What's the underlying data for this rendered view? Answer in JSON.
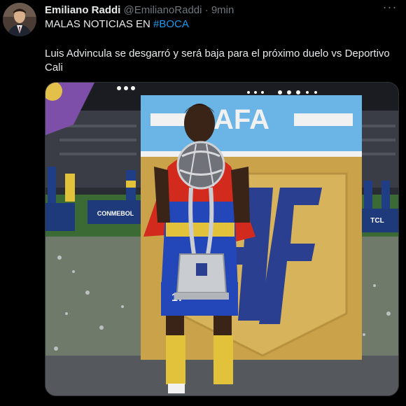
{
  "author": {
    "display_name": "Emiliano Raddi",
    "handle": "@EmilianoRaddi",
    "separator": "·",
    "time": "9min"
  },
  "more_glyph": "···",
  "tweet": {
    "line1_prefix": "MALAS NOTICIAS EN ",
    "hashtag": "#BOCA",
    "line2": "Luis Advincula se desgarró y será baja para el próximo duelo vs Deportivo Cali"
  },
  "media": {
    "banner_text": "AFA",
    "jersey_number": "17",
    "ad_board_left": "CONMEBOL",
    "ad_board_right": "TCL",
    "colors": {
      "sky_blue": "#6ab4e6",
      "gold": "#c9a24a",
      "navy": "#2a3f8f",
      "red_flag": "#d32a1e"
    }
  }
}
